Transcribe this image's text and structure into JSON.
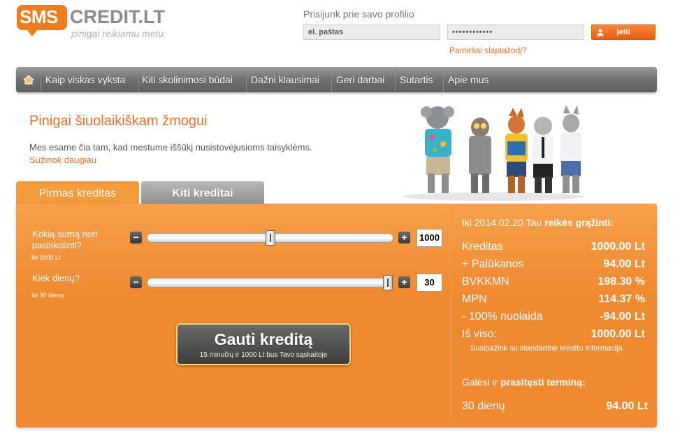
{
  "brand": {
    "logo_sms": "SMS",
    "logo_credit": "CREDIT.LT",
    "tagline": "pinigai reikiamu metu",
    "accent_color": "#f07c1e"
  },
  "login": {
    "title": "Prisijunk prie savo profilio",
    "email_placeholder": "el. paštas",
    "password_value": "••••••••••••",
    "button_label": "Įeiti",
    "forgot_label": "Pamiršai slaptažodį?"
  },
  "nav": {
    "home_icon": "home-icon",
    "items": [
      {
        "label": "Kaip viskas vyksta"
      },
      {
        "label": "Kiti skolinimosi būdai"
      },
      {
        "label": "Dažni klausimai"
      },
      {
        "label": "Geri darbai"
      },
      {
        "label": "Sutartis"
      },
      {
        "label": "Apie mus"
      }
    ]
  },
  "hero": {
    "title": "Pinigai šiuolaikiškam žmogui",
    "text": "Mes esame čia tam, kad mestume iššūkį nusistovėjusioms taisyklėms.",
    "link": "Sužinok daugiau",
    "illustration": "mascot-animals"
  },
  "tabs": [
    {
      "label": "Pirmas kreditas",
      "active": true
    },
    {
      "label": "Kiti kreditai",
      "active": false
    }
  ],
  "calculator": {
    "amount": {
      "label": "Kokią sumą nori pasiskolinti?",
      "hint": "Iki 2000 Lt",
      "value": "1000",
      "min": 0,
      "max": 2000
    },
    "days": {
      "label": "Kiek dienų?",
      "hint": "Iki 30 dienų",
      "value": "30",
      "min": 0,
      "max": 30
    },
    "minus": "−",
    "plus": "+",
    "cta_main": "Gauti kreditą",
    "cta_sub": "15 minučių ir 1000 Lt bus Tavo sąskaitoje"
  },
  "summary": {
    "head_prefix": "Iki 2014.02.20 Tau ",
    "head_bold": "reikės grąžinti:",
    "rows": [
      {
        "label": "Kreditas",
        "value": "1000.00 Lt"
      },
      {
        "label": "+ Palūkanos",
        "value": "94.00 Lt"
      },
      {
        "label": "BVKKMN",
        "value": "198.30 %"
      },
      {
        "label": "MPN",
        "value": "114.37 %"
      },
      {
        "label": "- 100% nuolaida",
        "value": "-94.00 Lt"
      },
      {
        "label": "Iš viso:",
        "value": "1000.00 Lt"
      }
    ],
    "note": "Susipažink su standartine kredito informacija",
    "extend_prefix": "Galėsi ir ",
    "extend_bold": "prasitęsti terminą:",
    "extend_label": "30 dienų",
    "extend_value": "94.00 Lt"
  }
}
